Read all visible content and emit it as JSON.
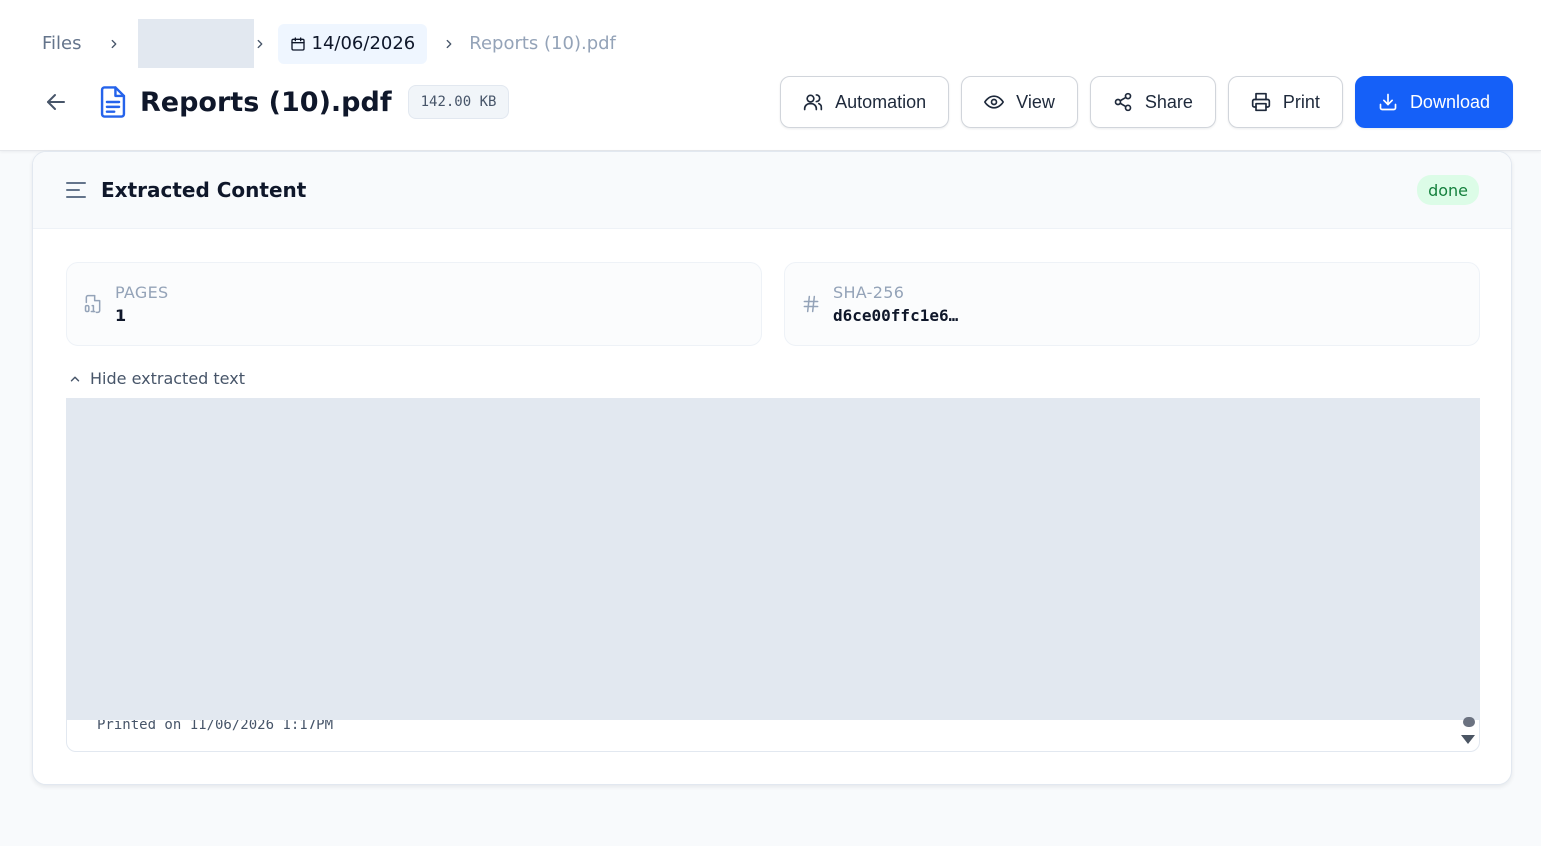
{
  "breadcrumb": {
    "root": "Files",
    "date": "14/06/2026",
    "current": "Reports (10).pdf"
  },
  "file": {
    "title": "Reports (10).pdf",
    "size": "142.00 KB"
  },
  "actions": {
    "automation": "Automation",
    "view": "View",
    "share": "Share",
    "print": "Print",
    "download": "Download"
  },
  "extracted": {
    "title": "Extracted Content",
    "status": "done",
    "pages_label": "PAGES",
    "pages_value": "1",
    "sha_label": "SHA-256",
    "sha_value": "d6ce00ffc1e6…",
    "toggle_label": "Hide extracted text",
    "visible_line": "Printed on 11/06/2026 1:17PM"
  },
  "icons": {
    "back": "arrow-left-icon",
    "file": "file-text-icon",
    "calendar": "calendar-icon",
    "automation": "users-icon",
    "view": "eye-icon",
    "share": "share-icon",
    "print": "printer-icon",
    "download": "download-icon",
    "content": "align-left-icon",
    "pages": "file-digit-icon",
    "sha": "hash-icon",
    "toggle": "chevron-up-icon"
  },
  "colors": {
    "primary": "#1560f8",
    "status_bg": "#dcfce7",
    "status_text": "#15803d",
    "file_icon": "#2563eb"
  }
}
